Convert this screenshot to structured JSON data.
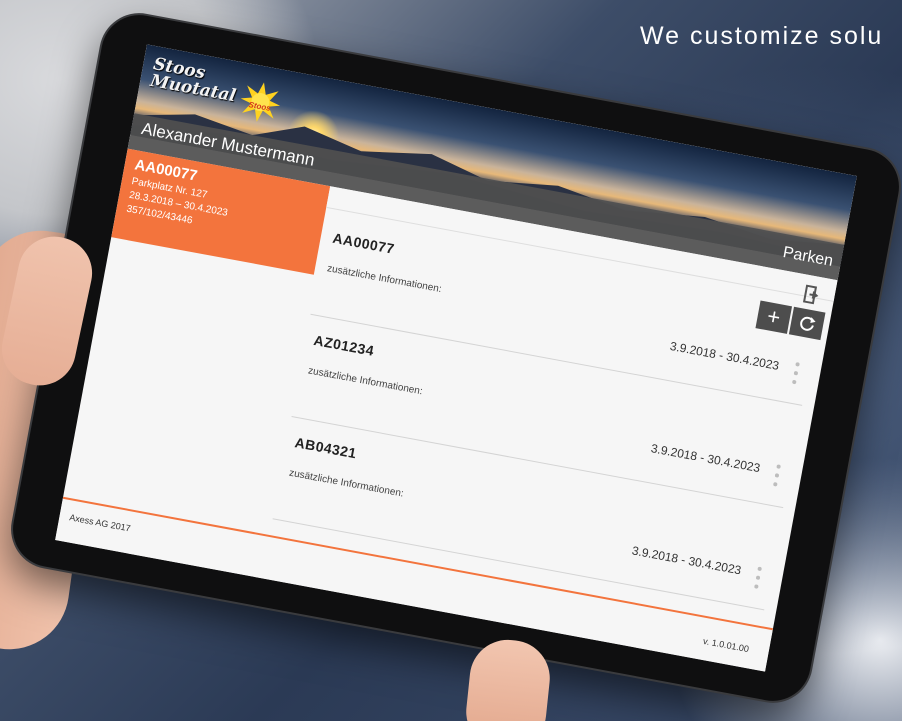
{
  "overlay": {
    "tagline": "We customize solu"
  },
  "app": {
    "brand_line1": "Stoos",
    "brand_line2": "Muotatal",
    "brand_badge": "Stoos",
    "user_name": "Alexander Mustermann",
    "section_title": "Parken"
  },
  "selected": {
    "code": "AA00077",
    "lines": [
      "Parkplatz Nr. 127",
      "28.3.2018 – 30.4.2023",
      "357/102/43446"
    ]
  },
  "toolbar": {
    "icons": {
      "exit": "logout-icon",
      "add": "plus-icon",
      "refresh": "refresh-icon"
    }
  },
  "list": [
    {
      "code": "AA00077",
      "label": "zusätzliche Informationen:",
      "date": "3.9.2018 - 30.4.2023"
    },
    {
      "code": "AZ01234",
      "label": "zusätzliche Informationen:",
      "date": "3.9.2018 - 30.4.2023"
    },
    {
      "code": "AB04321",
      "label": "zusätzliche Informationen:",
      "date": "3.9.2018 - 30.4.2023"
    }
  ],
  "footer": {
    "copyright": "Axess AG 2017",
    "version": "v. 1.0.01.00"
  },
  "colors": {
    "accent": "#f3743d",
    "bar": "#505050",
    "screen_bg": "#f6f6f6"
  }
}
